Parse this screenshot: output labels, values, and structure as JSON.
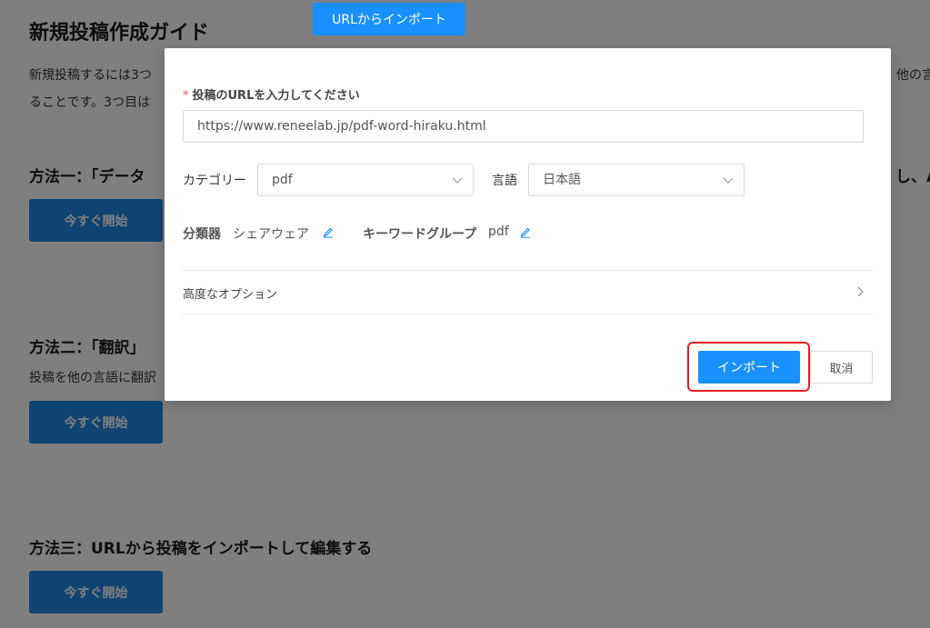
{
  "background": {
    "page_title": "新規投稿作成ガイド",
    "intro_line1": "新規投稿するには3つ",
    "intro_line1_right": "他の言",
    "intro_line2": "ることです。3つ目は",
    "method1_title": "方法一：「データ",
    "method1_title_right": "し、A",
    "method2_title": "方法二：「翻訳」",
    "method2_desc": "投稿を他の言語に翻訳",
    "method3_title": "方法三：URLから投稿をインポートして編集する",
    "start_label": "今すぐ開始"
  },
  "top_tab": {
    "label": "URLからインポート"
  },
  "modal": {
    "required_mark": "*",
    "url_label": "投稿のURLを入力してください",
    "url_value": "https://www.reneelab.jp/pdf-word-hiraku.html",
    "category_label": "カテゴリー",
    "category_value": "pdf",
    "language_label": "言語",
    "language_value": "日本語",
    "classifier_label": "分類器",
    "classifier_value": "シェアウェア",
    "keyword_group_label": "キーワードグループ",
    "keyword_group_value": "pdf",
    "advanced_options_label": "高度なオプション",
    "import_label": "インポート",
    "cancel_label": "取消"
  },
  "colors": {
    "primary": "#1890ff",
    "start_button": "#1e88e5",
    "highlight": "#e31e24",
    "required": "#ff4d4f"
  },
  "icons": {
    "select_arrow": "chevron-down-icon",
    "edit": "pencil-icon",
    "expand": "chevron-right-icon"
  }
}
